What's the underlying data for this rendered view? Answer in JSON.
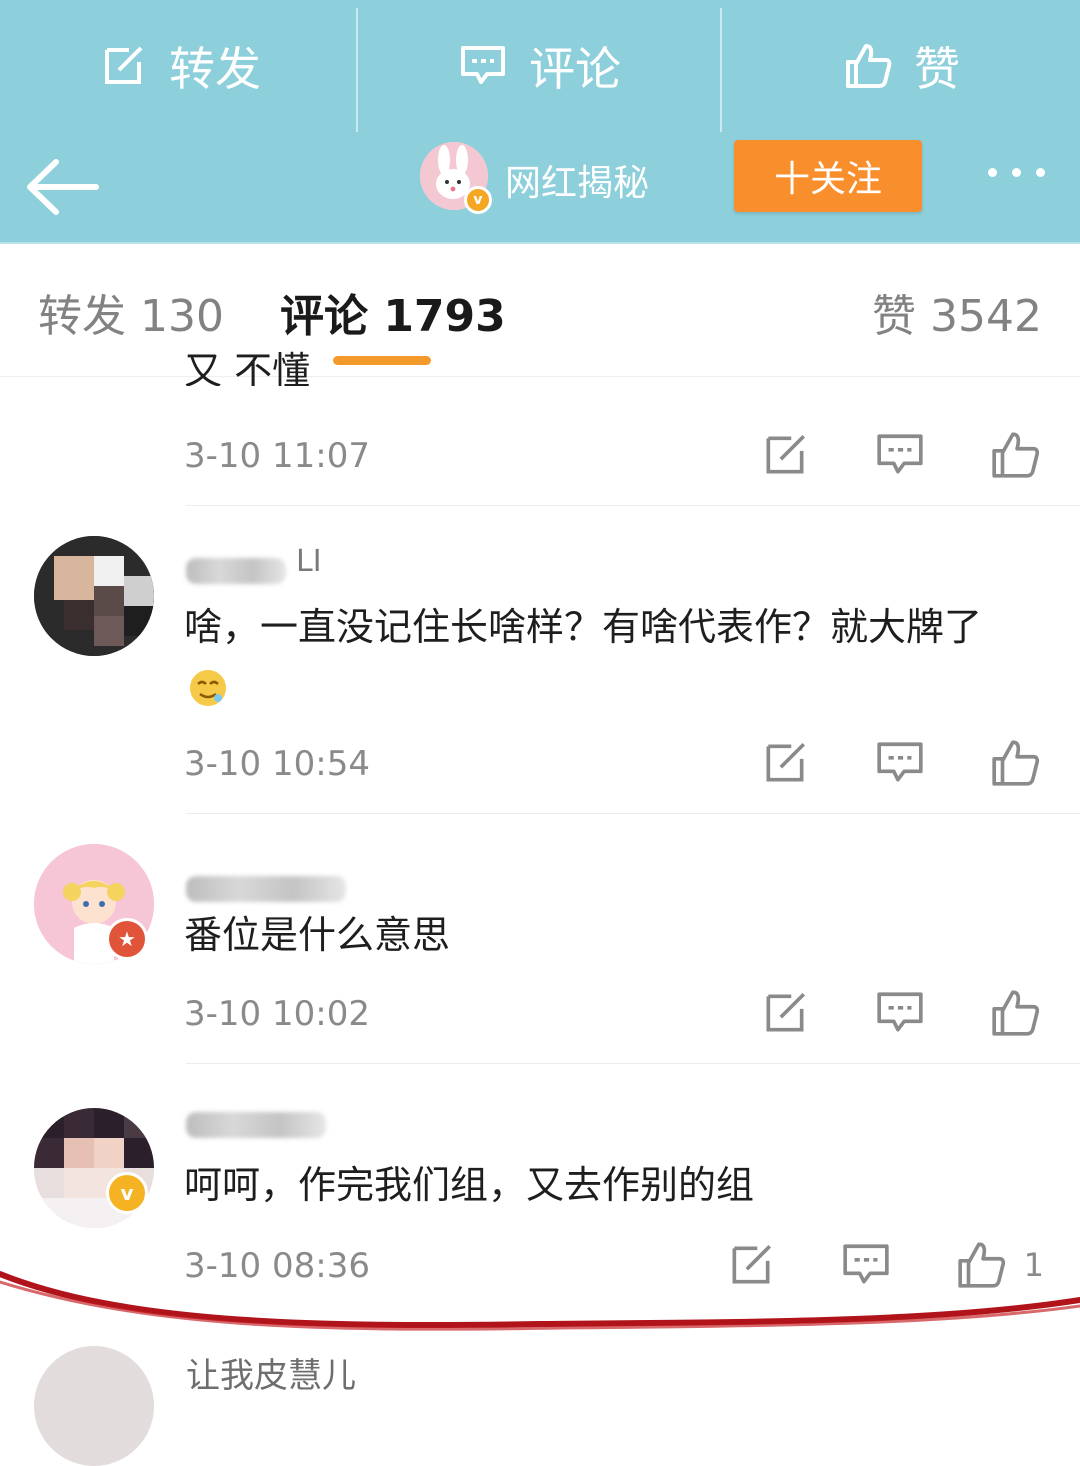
{
  "colors": {
    "bar_bg": "#8dcfdb",
    "follow_bg": "#f98e2c",
    "tab_indicator": "#f39a2b",
    "text_muted": "#8a8a8a",
    "annotation_red": "#b0141a"
  },
  "top_actions": [
    {
      "icon": "repost-icon",
      "label": "转发"
    },
    {
      "icon": "comment-icon",
      "label": "评论"
    },
    {
      "icon": "like-icon",
      "label": "赞"
    }
  ],
  "nav": {
    "back_icon": "arrow-left-icon",
    "account_name": "网红揭秘",
    "follow_label": "十关注",
    "more_icon": "more-dots-icon"
  },
  "tabs": {
    "repost": "转发 130",
    "comment": "评论 1793",
    "like": "赞 3542"
  },
  "comments": [
    {
      "username": "",
      "text": "又 不懂",
      "time": "3-10 11:07",
      "likes": ""
    },
    {
      "username": "LI",
      "text": "啥，一直没记住长啥样？有啥代表作？就大牌了",
      "time": "3-10 10:54",
      "likes": ""
    },
    {
      "username": "",
      "text": "番位是什么意思",
      "time": "3-10 10:02",
      "likes": ""
    },
    {
      "username": "",
      "text": "呵呵，作完我们组，又去作别的组",
      "time": "3-10 08:36",
      "likes": "1"
    },
    {
      "username": "让我皮慧儿",
      "text": "",
      "time": "",
      "likes": ""
    }
  ]
}
